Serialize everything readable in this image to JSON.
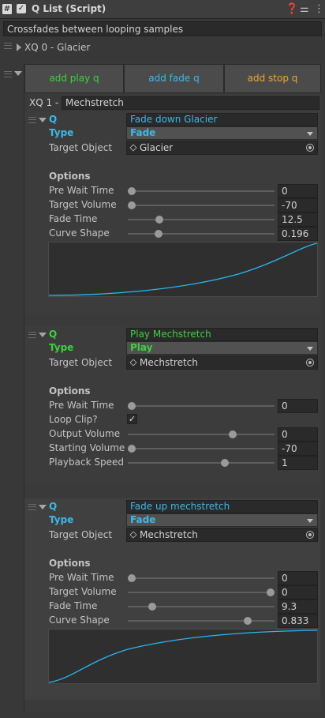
{
  "header": {
    "title": "Q List (Script)",
    "enabled": true
  },
  "description": "Crossfades between looping samples",
  "xq0": {
    "label": "XQ 0 - Glacier"
  },
  "buttons": [
    {
      "label": "add play q",
      "color": "#3ed03e"
    },
    {
      "label": "add fade q",
      "color": "#3cb8e8"
    },
    {
      "label": "add stop q",
      "color": "#e8a838"
    }
  ],
  "xq1": {
    "label": "XQ 1 -",
    "name": "Mechstretch"
  },
  "colors": {
    "fade": "#3cb8e8",
    "play": "#3ed03e",
    "curve": "#28b8f0"
  },
  "labels": {
    "q": "Q",
    "type": "Type",
    "target_object": "Target Object",
    "options": "Options",
    "pre_wait_time": "Pre Wait Time",
    "target_volume": "Target Volume",
    "fade_time": "Fade Time",
    "curve_shape": "Curve Shape",
    "loop_clip": "Loop Clip?",
    "output_volume": "Output Volume",
    "starting_volume": "Starting Volume",
    "playback_speed": "Playback Speed"
  },
  "q1": {
    "name": "Fade down Glacier",
    "type": "Fade",
    "target": "Glacier",
    "pre_wait_time": "0",
    "target_volume": "-70",
    "fade_time": "12.5",
    "curve_shape": "0.196",
    "slider_fractions": [
      0.0,
      0.0,
      0.2,
      0.196
    ]
  },
  "q2": {
    "name": "Play Mechstretch",
    "type": "Play",
    "target": "Mechstretch",
    "pre_wait_time": "0",
    "loop_clip": true,
    "output_volume": "0",
    "starting_volume": "-70",
    "playback_speed": "1",
    "slider_fractions": [
      0.0,
      0.73,
      0.0,
      0.67
    ]
  },
  "q3": {
    "name": "Fade up mechstretch",
    "type": "Fade",
    "target": "Mechstretch",
    "pre_wait_time": "0",
    "target_volume": "0",
    "fade_time": "9.3",
    "curve_shape": "0.833",
    "slider_fractions": [
      0.0,
      1.0,
      0.15,
      0.833
    ]
  }
}
